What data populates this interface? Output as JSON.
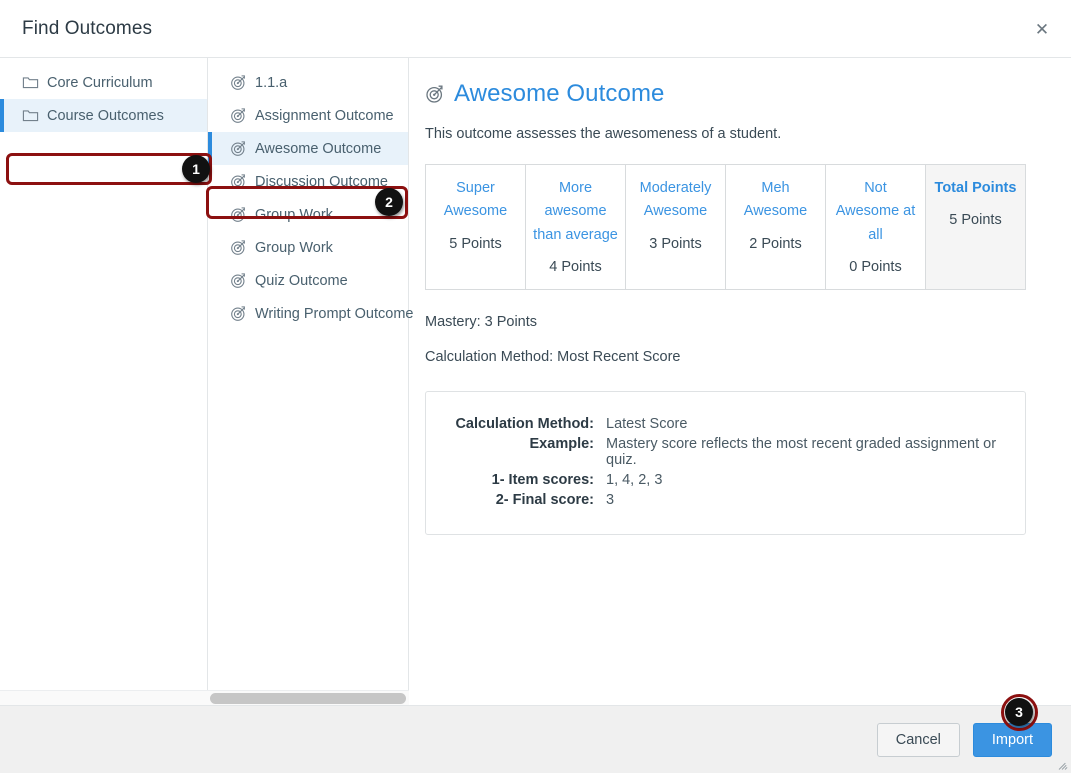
{
  "dialog": {
    "title": "Find Outcomes",
    "close_label": "✕"
  },
  "directories": {
    "items": [
      {
        "label": "Core Curriculum",
        "icon": "folder-icon",
        "selected": false
      },
      {
        "label": "Course Outcomes",
        "icon": "folder-icon",
        "selected": true
      }
    ]
  },
  "outcomes": {
    "items": [
      {
        "label": "1.1.a",
        "icon": "outcome-target-icon",
        "selected": false
      },
      {
        "label": "Assignment Outcome",
        "icon": "outcome-target-icon",
        "selected": false
      },
      {
        "label": "Awesome Outcome",
        "icon": "outcome-target-icon",
        "selected": true
      },
      {
        "label": "Discussion Outcome",
        "icon": "outcome-target-icon",
        "selected": false
      },
      {
        "label": "Group Work",
        "icon": "outcome-target-icon",
        "selected": false
      },
      {
        "label": "Group Work",
        "icon": "outcome-target-icon",
        "selected": false
      },
      {
        "label": "Quiz Outcome",
        "icon": "outcome-target-icon",
        "selected": false
      },
      {
        "label": "Writing Prompt Outcome",
        "icon": "outcome-target-icon",
        "selected": false
      }
    ]
  },
  "detail": {
    "title": "Awesome Outcome",
    "description": "This outcome assesses the awesomeness of a student.",
    "ratings": [
      {
        "description": "Super Awesome",
        "points": "5 Points",
        "total": false
      },
      {
        "description": "More awesome than average",
        "points": "4 Points",
        "total": false
      },
      {
        "description": "Moderately Awesome",
        "points": "3 Points",
        "total": false
      },
      {
        "description": "Meh Awesome",
        "points": "2 Points",
        "total": false
      },
      {
        "description": "Not Awesome at all",
        "points": "0 Points",
        "total": false
      },
      {
        "description": "Total Points",
        "points": "5 Points",
        "total": true
      }
    ],
    "mastery": "Mastery: 3 Points",
    "calculation_method": "Calculation Method: Most Recent Score",
    "example_box": {
      "rows": [
        {
          "key": "Calculation Method:",
          "value": "Latest Score"
        },
        {
          "key": "Example:",
          "value": "Mastery score reflects the most recent graded assignment or quiz."
        },
        {
          "key": "1- Item scores:",
          "value": "1, 4, 2, 3"
        },
        {
          "key": "2- Final score:",
          "value": "3"
        }
      ]
    }
  },
  "footer": {
    "cancel_label": "Cancel",
    "import_label": "Import"
  },
  "annotations": {
    "badge1": "1",
    "badge2": "2",
    "badge3": "3"
  },
  "colors": {
    "accent_blue": "#2c8bdd",
    "link_blue": "#3b94e2",
    "selected_bg": "#e8f2fa",
    "callout_red": "#8c1010",
    "badge_black": "#111111",
    "text_dark": "#2d3b45"
  }
}
